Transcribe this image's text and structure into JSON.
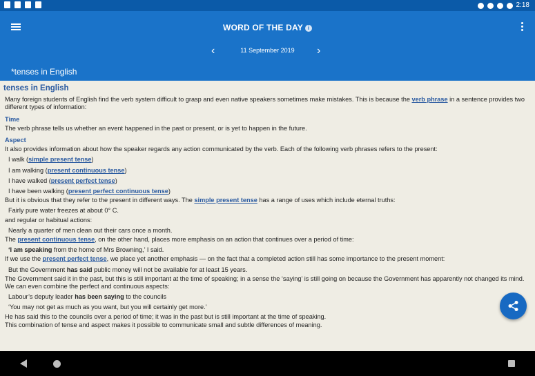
{
  "status_bar": {
    "time": "2:18"
  },
  "app_bar": {
    "title": "WORD OF THE DAY",
    "date": "11 September 2019",
    "subtitle": "*tenses in English"
  },
  "article": {
    "heading": "tenses in English",
    "intro_1": "Many foreign students of English find the verb system difficult to grasp and even native speakers sometimes make mistakes. This is because the ",
    "intro_link": "verb phrase",
    "intro_2": " in a sentence provides two different types of information:",
    "time_heading": "Time",
    "time_text": "The verb phrase tells us whether an event happened in the past or present, or is yet to happen in the future.",
    "aspect_heading": "Aspect",
    "aspect_text": "It also provides information about how the speaker regards any action communicated by the verb. Each of the following verb phrases refers to the present:",
    "examples": [
      {
        "text": "I walk (",
        "link": "simple present tense",
        "after": ")"
      },
      {
        "text": "I am walking (",
        "link": "present continuous tense",
        "after": ")"
      },
      {
        "text": "I have walked (",
        "link": "present perfect tense",
        "after": ")"
      },
      {
        "text": "I have been walking (",
        "link": "present perfect continuous tense",
        "after": ")"
      }
    ],
    "p_simple_1": "But it is obvious that they refer to the present in different ways. The ",
    "p_simple_link": "simple present tense",
    "p_simple_2": " has a range of uses which include eternal truths:",
    "ex_water": "Fairly pure water freezes at about 0° C.",
    "p_regular": "and regular or habitual actions:",
    "ex_men": "Nearly a quarter of men clean out their cars once a month.",
    "p_cont_1": "The ",
    "p_cont_link": "present continuous tense",
    "p_cont_2": ", on the other hand, places more emphasis on an action that continues over a period of time:",
    "ex_speaking_bold": "‘I am speaking",
    "ex_speaking_rest": " from the home of Mrs Browning,’ I said.",
    "p_perf_1": "If we use the ",
    "p_perf_link": "present perfect tense",
    "p_perf_2": ", we place yet another emphasis — on the fact that a completed action still has some importance to the present moment:",
    "ex_gov_1": "But the Government ",
    "ex_gov_bold": "has said",
    "ex_gov_2": " public money will not be available for at least 15 years.",
    "p_gov": "The Government said it in the past, but this is still important at the time of speaking; in a sense the ‘saying’ is still going on because the Government has apparently not changed its mind. We can even combine the perfect and continuous aspects:",
    "ex_labour_1": "Labour’s deputy leader ",
    "ex_labour_bold": "has been saying",
    "ex_labour_2": " to the councils",
    "ex_quote": "‘You may not get as much as you want, but you will certainly get more.’",
    "p_said": "He has said this to the councils over a period of time; it was in the past but is still important at the time of speaking.",
    "p_combo": "This combination of tense and aspect makes it possible to communicate small and subtle differences of meaning."
  },
  "colors": {
    "app_bar": "#1a73c9",
    "status_bar": "#0b5aa8",
    "link": "#2a5aa0",
    "background": "#efede4"
  }
}
